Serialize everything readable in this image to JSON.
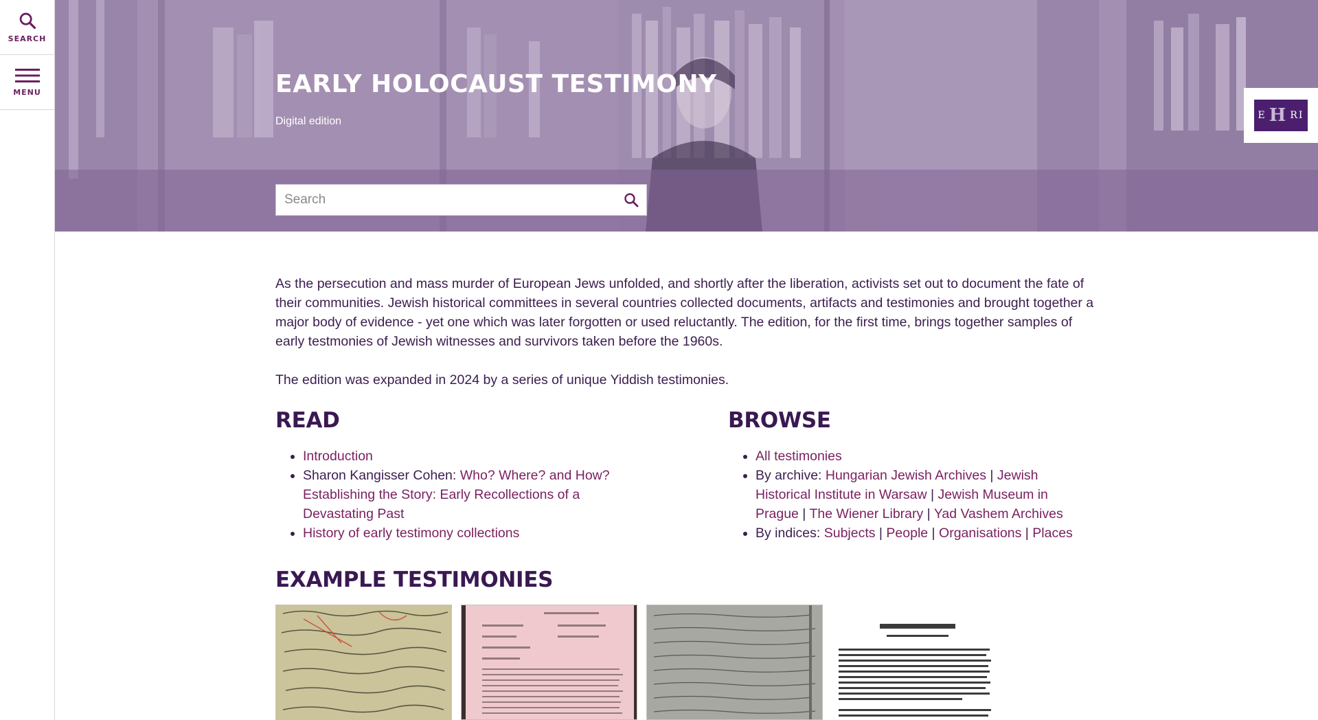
{
  "sidebar": {
    "search_label": "SEARCH",
    "menu_label": "MENU"
  },
  "hero": {
    "title": "EARLY HOLOCAUST TESTIMONY",
    "subtitle": "Digital edition",
    "search_placeholder": "Search",
    "logo_text_left": "E",
    "logo_text_mid": "H",
    "logo_text_right": "RI"
  },
  "intro": {
    "paragraph1": "As the persecution and mass murder of European Jews unfolded, and shortly after the liberation, activists set out to document the fate of their communities. Jewish historical committees in several countries collected documents, artifacts and testimonies and brought together a major body of evidence - yet one which was later forgotten or used reluctantly. The edition, for the first time, brings together samples of early testmonies of Jewish witnesses and survivors taken before the 1960s.",
    "paragraph2": "The edition was expanded in 2024 by a series of unique Yiddish testimonies."
  },
  "read": {
    "title": "READ",
    "introduction": "Introduction",
    "author_prefix": "Sharon Kangisser Cohen: ",
    "essay_title": "Who? Where? and How? Establishing the Story: Early Recollections of a Devastating Past",
    "history": "History of early testimony collections"
  },
  "browse": {
    "title": "BROWSE",
    "all": "All testimonies",
    "by_archive_label": "By archive: ",
    "archives": [
      "Hungarian Jewish Archives",
      "Jewish Historical Institute in Warsaw",
      "Jewish Museum in Prague",
      "The Wiener Library",
      "Yad Vashem Archives"
    ],
    "by_indices_label": "By indices: ",
    "indices": [
      "Subjects",
      "People",
      "Organisations",
      "Places"
    ],
    "separator": " | "
  },
  "examples": {
    "title": "EXAMPLE TESTIMONIES"
  },
  "colors": {
    "accent": "#7a1f5f",
    "heading": "#3a1852",
    "text": "#3b1d4e",
    "hero_overlay": "#9e86ad",
    "logo_bg": "#4b1f6e"
  }
}
